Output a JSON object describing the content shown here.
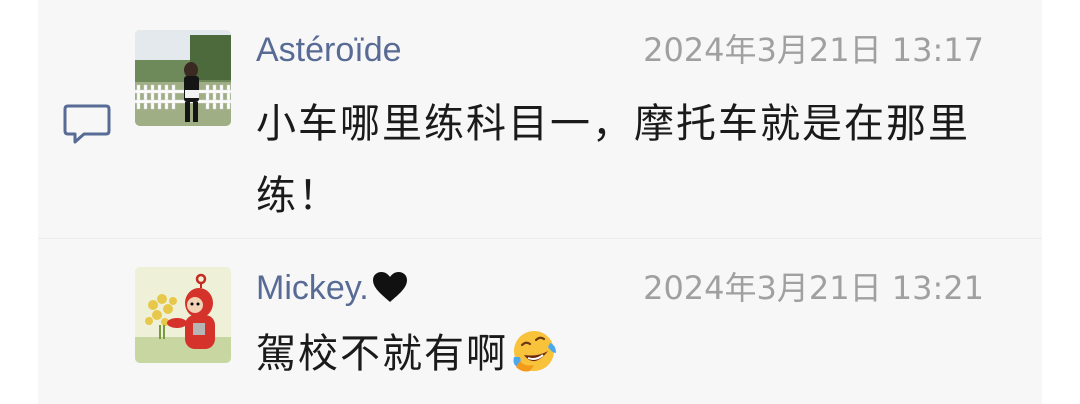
{
  "comments": [
    {
      "author": "Astéroïde",
      "time": "2024年3月21日 13:17",
      "text": "小车哪里练科目一，摩托车就是在那里练！",
      "avatar_icon": "person-photo-avatar"
    },
    {
      "author": "Mickey.",
      "author_emoji": "black-heart-icon",
      "time": "2024年3月21日 13:21",
      "text": "駕校不就有啊",
      "text_emoji": "loudly-crying-laughing-face-icon",
      "avatar_icon": "teletubby-with-flowers-avatar"
    }
  ],
  "icons": {
    "comment": "comment-bubble-icon"
  },
  "colors": {
    "author_name": "#576b95",
    "timestamp": "#a0a0a0",
    "text": "#1a1a1a",
    "panel_background": "#f7f7f7"
  }
}
